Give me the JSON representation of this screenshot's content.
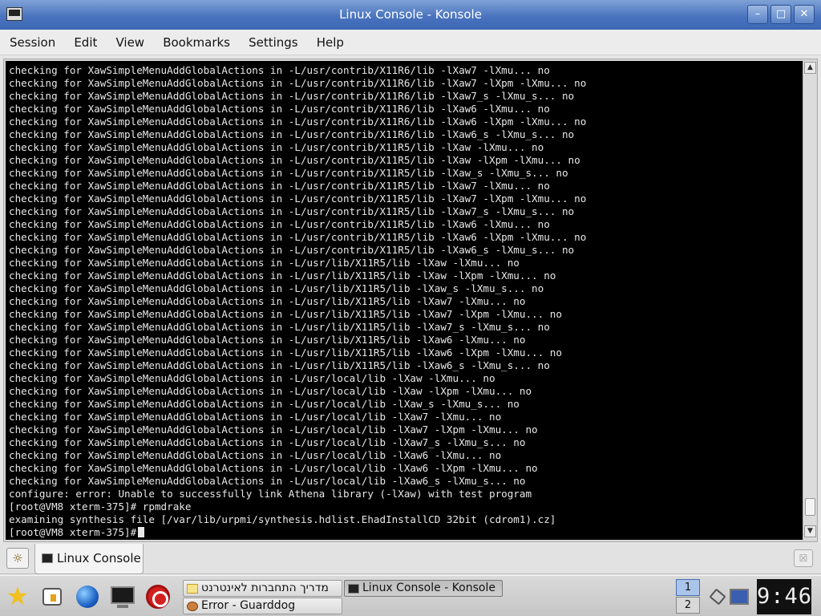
{
  "window": {
    "title": "Linux Console - Konsole",
    "buttons": {
      "minimize": "–",
      "maximize": "□",
      "close": "✕"
    }
  },
  "menubar": {
    "items": [
      "Session",
      "Edit",
      "View",
      "Bookmarks",
      "Settings",
      "Help"
    ]
  },
  "terminal": {
    "lines": [
      "checking for XawSimpleMenuAddGlobalActions in -L/usr/contrib/X11R6/lib -lXaw7 -lXmu... no",
      "checking for XawSimpleMenuAddGlobalActions in -L/usr/contrib/X11R6/lib -lXaw7 -lXpm -lXmu... no",
      "checking for XawSimpleMenuAddGlobalActions in -L/usr/contrib/X11R6/lib -lXaw7_s -lXmu_s... no",
      "checking for XawSimpleMenuAddGlobalActions in -L/usr/contrib/X11R6/lib -lXaw6 -lXmu... no",
      "checking for XawSimpleMenuAddGlobalActions in -L/usr/contrib/X11R6/lib -lXaw6 -lXpm -lXmu... no",
      "checking for XawSimpleMenuAddGlobalActions in -L/usr/contrib/X11R6/lib -lXaw6_s -lXmu_s... no",
      "checking for XawSimpleMenuAddGlobalActions in -L/usr/contrib/X11R5/lib -lXaw -lXmu... no",
      "checking for XawSimpleMenuAddGlobalActions in -L/usr/contrib/X11R5/lib -lXaw -lXpm -lXmu... no",
      "checking for XawSimpleMenuAddGlobalActions in -L/usr/contrib/X11R5/lib -lXaw_s -lXmu_s... no",
      "checking for XawSimpleMenuAddGlobalActions in -L/usr/contrib/X11R5/lib -lXaw7 -lXmu... no",
      "checking for XawSimpleMenuAddGlobalActions in -L/usr/contrib/X11R5/lib -lXaw7 -lXpm -lXmu... no",
      "checking for XawSimpleMenuAddGlobalActions in -L/usr/contrib/X11R5/lib -lXaw7_s -lXmu_s... no",
      "checking for XawSimpleMenuAddGlobalActions in -L/usr/contrib/X11R5/lib -lXaw6 -lXmu... no",
      "checking for XawSimpleMenuAddGlobalActions in -L/usr/contrib/X11R5/lib -lXaw6 -lXpm -lXmu... no",
      "checking for XawSimpleMenuAddGlobalActions in -L/usr/contrib/X11R5/lib -lXaw6_s -lXmu_s... no",
      "checking for XawSimpleMenuAddGlobalActions in -L/usr/lib/X11R5/lib -lXaw -lXmu... no",
      "checking for XawSimpleMenuAddGlobalActions in -L/usr/lib/X11R5/lib -lXaw -lXpm -lXmu... no",
      "checking for XawSimpleMenuAddGlobalActions in -L/usr/lib/X11R5/lib -lXaw_s -lXmu_s... no",
      "checking for XawSimpleMenuAddGlobalActions in -L/usr/lib/X11R5/lib -lXaw7 -lXmu... no",
      "checking for XawSimpleMenuAddGlobalActions in -L/usr/lib/X11R5/lib -lXaw7 -lXpm -lXmu... no",
      "checking for XawSimpleMenuAddGlobalActions in -L/usr/lib/X11R5/lib -lXaw7_s -lXmu_s... no",
      "checking for XawSimpleMenuAddGlobalActions in -L/usr/lib/X11R5/lib -lXaw6 -lXmu... no",
      "checking for XawSimpleMenuAddGlobalActions in -L/usr/lib/X11R5/lib -lXaw6 -lXpm -lXmu... no",
      "checking for XawSimpleMenuAddGlobalActions in -L/usr/lib/X11R5/lib -lXaw6_s -lXmu_s... no",
      "checking for XawSimpleMenuAddGlobalActions in -L/usr/local/lib -lXaw -lXmu... no",
      "checking for XawSimpleMenuAddGlobalActions in -L/usr/local/lib -lXaw -lXpm -lXmu... no",
      "checking for XawSimpleMenuAddGlobalActions in -L/usr/local/lib -lXaw_s -lXmu_s... no",
      "checking for XawSimpleMenuAddGlobalActions in -L/usr/local/lib -lXaw7 -lXmu... no",
      "checking for XawSimpleMenuAddGlobalActions in -L/usr/local/lib -lXaw7 -lXpm -lXmu... no",
      "checking for XawSimpleMenuAddGlobalActions in -L/usr/local/lib -lXaw7_s -lXmu_s... no",
      "checking for XawSimpleMenuAddGlobalActions in -L/usr/local/lib -lXaw6 -lXmu... no",
      "checking for XawSimpleMenuAddGlobalActions in -L/usr/local/lib -lXaw6 -lXpm -lXmu... no",
      "checking for XawSimpleMenuAddGlobalActions in -L/usr/local/lib -lXaw6_s -lXmu_s... no",
      "configure: error: Unable to successfully link Athena library (-lXaw) with test program",
      "[root@VM8 xterm-375]# rpmdrake",
      "examining synthesis file [/var/lib/urpmi/synthesis.hdlist.EhadInstallCD 32bit (cdrom1).cz]"
    ],
    "prompt": "[root@VM8 xterm-375]# "
  },
  "tabbar": {
    "session_tab": "Linux Console"
  },
  "taskbar": {
    "tasks": {
      "internet_guide": "מדריך התחברות לאינטרנט",
      "guarddog": "Error - Guarddog",
      "konsole": "Linux Console - Konsole"
    },
    "pager": [
      "1",
      "2"
    ],
    "clock": "9:46"
  },
  "icons": {
    "app": "konsole-icon",
    "new_session": "new-session-icon",
    "launcher_kmenu": "star-icon",
    "launcher_home": "home-icon",
    "launcher_browser": "globe-icon",
    "launcher_terminal": "terminal-icon",
    "launcher_guarddog": "guarddog-icon",
    "tray_network": "network-plug-icon",
    "tray_display": "display-icon"
  },
  "colors": {
    "titlebar": "#4a74bf",
    "terminal_bg": "#000000",
    "terminal_fg": "#e8e8e8",
    "pager_active": "#aac4ea"
  }
}
